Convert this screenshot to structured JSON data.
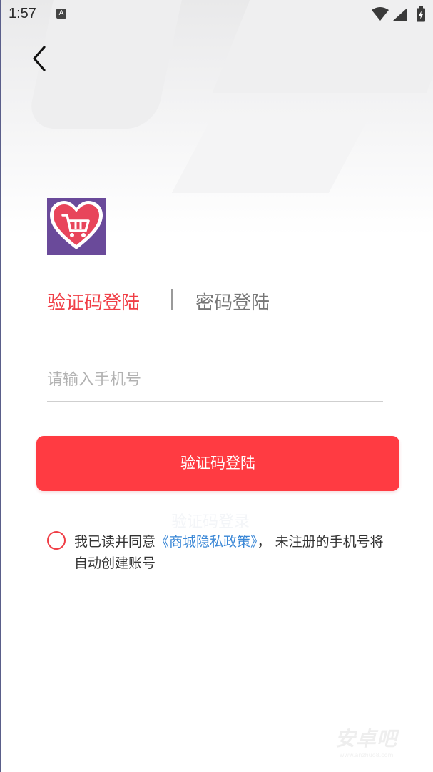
{
  "status_bar": {
    "time": "1:57",
    "notification_letter": "A"
  },
  "login": {
    "tab_code": "验证码登陆",
    "tab_password": "密码登陆",
    "phone_placeholder": "请输入手机号",
    "login_button": "验证码登陆",
    "ghost_text": "验证码登录",
    "agree_prefix": "我已读并同意",
    "agree_link": "《商城隐私政策》",
    "agree_suffix": "，  未注册的手机号将自动创建账号"
  },
  "watermark": {
    "text": "安卓吧",
    "sub": "www.anzhuo8.com"
  },
  "colors": {
    "accent": "#f03e46",
    "button": "#ff3b42",
    "link": "#3a87d6",
    "logo_bg": "#6a4a9a"
  },
  "icons": {
    "back": "chevron-left-icon",
    "logo": "heart-cart-logo"
  }
}
